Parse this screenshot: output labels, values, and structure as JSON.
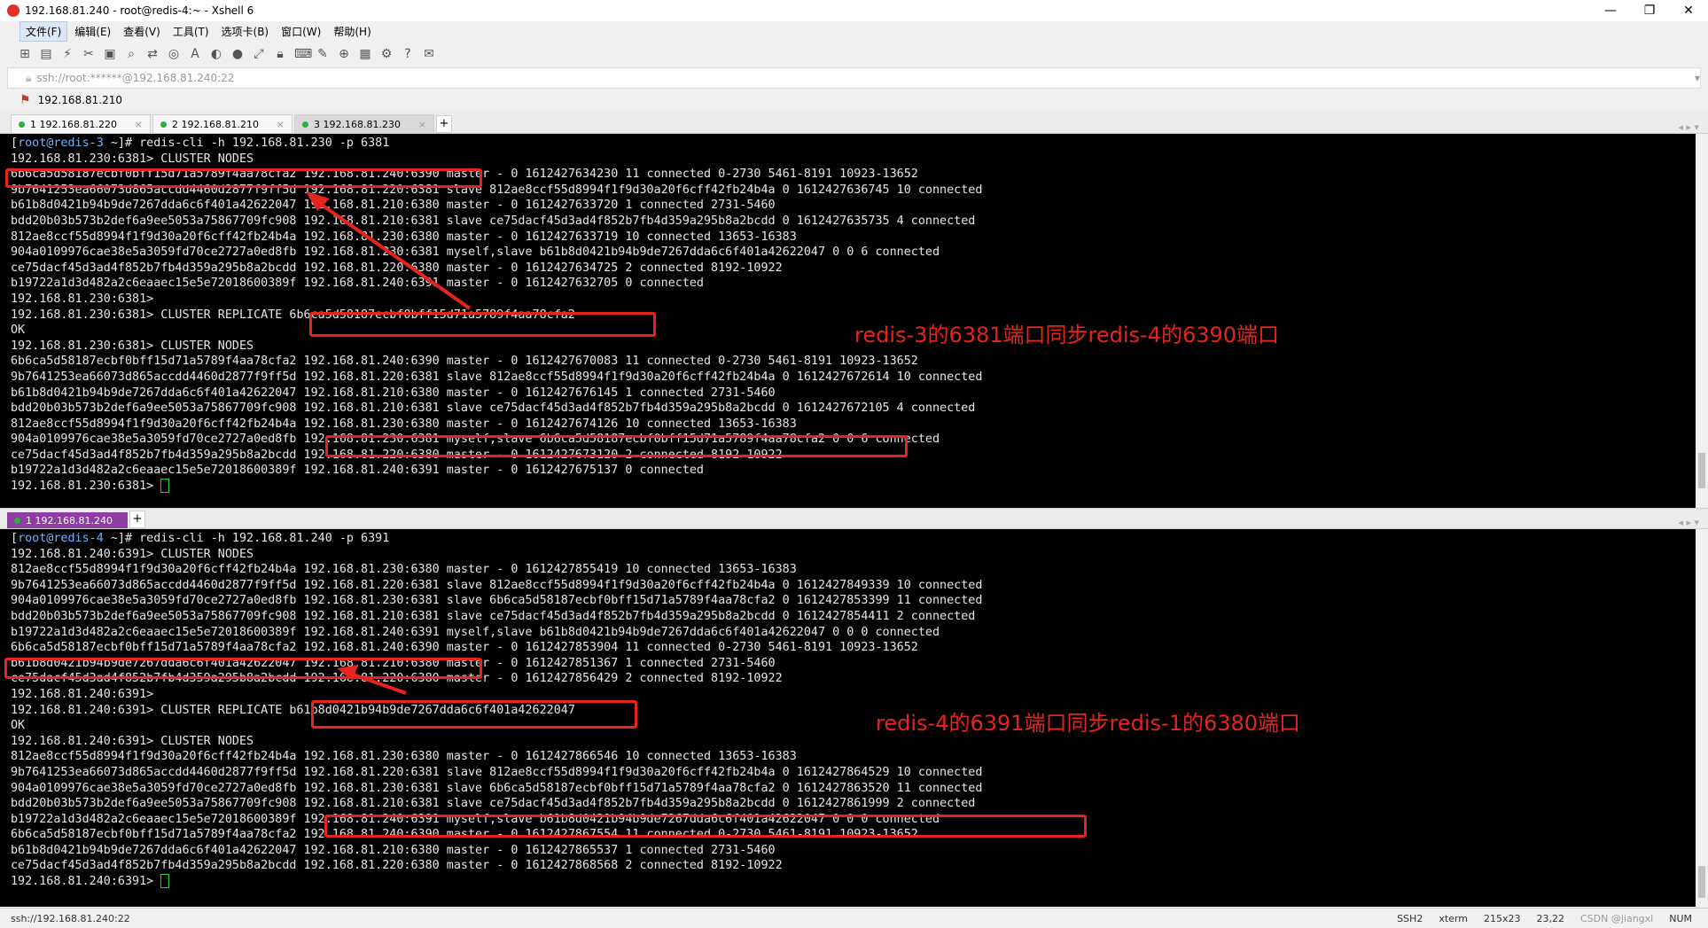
{
  "window": {
    "title": "192.168.81.240 - root@redis-4:~ - Xshell 6",
    "controls": [
      "—",
      "❐",
      "✕"
    ]
  },
  "menu": [
    "文件(F)",
    "编辑(E)",
    "查看(V)",
    "工具(T)",
    "选项卡(B)",
    "窗口(W)",
    "帮助(H)"
  ],
  "address": "ssh://root:******@192.168.81.240:22",
  "session_bar_label": "192.168.81.210",
  "tabs": [
    {
      "label": "1 192.168.81.220"
    },
    {
      "label": "2 192.168.81.210"
    },
    {
      "label": "3 192.168.81.230"
    }
  ],
  "pane2_tab": "1 192.168.81.240",
  "terminal1": {
    "prompt_user": "root@redis-3",
    "prompt_path": " ~]# redis-cli -h 192.168.81.230 -p 6381",
    "lines": [
      "192.168.81.230:6381> CLUSTER NODES",
      "6b6ca5d58187ecbf0bff15d71a5789f4aa78cfa2 192.168.81.240:6390 master - 0 1612427634230 11 connected 0-2730 5461-8191 10923-13652",
      "9b7641253ea66073d865accdd4460d2877f9ff5d 192.168.81.220:6381 slave 812ae8ccf55d8994f1f9d30a20f6cff42fb24b4a 0 1612427636745 10 connected",
      "b61b8d0421b94b9de7267dda6c6f401a42622047 192.168.81.210:6380 master - 0 1612427633720 1 connected 2731-5460",
      "bdd20b03b573b2def6a9ee5053a75867709fc908 192.168.81.210:6381 slave ce75dacf45d3ad4f852b7fb4d359a295b8a2bcdd 0 1612427635735 4 connected",
      "812ae8ccf55d8994f1f9d30a20f6cff42fb24b4a 192.168.81.230:6380 master - 0 1612427633719 10 connected 13653-16383",
      "904a0109976cae38e5a3059fd70ce2727a0ed8fb 192.168.81.230:6381 myself,slave b61b8d0421b94b9de7267dda6c6f401a42622047 0 0 6 connected",
      "ce75dacf45d3ad4f852b7fb4d359a295b8a2bcdd 192.168.81.220:6380 master - 0 1612427634725 2 connected 8192-10922",
      "b19722a1d3d482a2c6eaaec15e5e72018600389f 192.168.81.240:6391 master - 0 1612427632705 0 connected",
      "192.168.81.230:6381>",
      "192.168.81.230:6381> CLUSTER REPLICATE 6b6ca5d58187ecbf0bff15d71a5789f4aa78cfa2",
      "OK",
      "192.168.81.230:6381> CLUSTER NODES",
      "6b6ca5d58187ecbf0bff15d71a5789f4aa78cfa2 192.168.81.240:6390 master - 0 1612427670083 11 connected 0-2730 5461-8191 10923-13652",
      "9b7641253ea66073d865accdd4460d2877f9ff5d 192.168.81.220:6381 slave 812ae8ccf55d8994f1f9d30a20f6cff42fb24b4a 0 1612427672614 10 connected",
      "b61b8d0421b94b9de7267dda6c6f401a42622047 192.168.81.210:6380 master - 0 1612427676145 1 connected 2731-5460",
      "bdd20b03b573b2def6a9ee5053a75867709fc908 192.168.81.210:6381 slave ce75dacf45d3ad4f852b7fb4d359a295b8a2bcdd 0 1612427672105 4 connected",
      "812ae8ccf55d8994f1f9d30a20f6cff42fb24b4a 192.168.81.230:6380 master - 0 1612427674126 10 connected 13653-16383",
      "904a0109976cae38e5a3059fd70ce2727a0ed8fb 192.168.81.230:6381 myself,slave 6b6ca5d58187ecbf0bff15d71a5789f4aa78cfa2 0 0 6 connected",
      "ce75dacf45d3ad4f852b7fb4d359a295b8a2bcdd 192.168.81.220:6380 master - 0 1612427673120 2 connected 8192-10922",
      "b19722a1d3d482a2c6eaaec15e5e72018600389f 192.168.81.240:6391 master - 0 1612427675137 0 connected"
    ],
    "final_prompt": "192.168.81.230:6381> ",
    "annotation": "redis-3的6381端口同步redis-4的6390端口"
  },
  "terminal2": {
    "prompt_user": "root@redis-4",
    "prompt_path": " ~]# redis-cli -h 192.168.81.240 -p 6391",
    "lines": [
      "192.168.81.240:6391> CLUSTER NODES",
      "812ae8ccf55d8994f1f9d30a20f6cff42fb24b4a 192.168.81.230:6380 master - 0 1612427855419 10 connected 13653-16383",
      "9b7641253ea66073d865accdd4460d2877f9ff5d 192.168.81.220:6381 slave 812ae8ccf55d8994f1f9d30a20f6cff42fb24b4a 0 1612427849339 10 connected",
      "904a0109976cae38e5a3059fd70ce2727a0ed8fb 192.168.81.230:6381 slave 6b6ca5d58187ecbf0bff15d71a5789f4aa78cfa2 0 1612427853399 11 connected",
      "bdd20b03b573b2def6a9ee5053a75867709fc908 192.168.81.210:6381 slave ce75dacf45d3ad4f852b7fb4d359a295b8a2bcdd 0 1612427854411 2 connected",
      "b19722a1d3d482a2c6eaaec15e5e72018600389f 192.168.81.240:6391 myself,slave b61b8d0421b94b9de7267dda6c6f401a42622047 0 0 0 connected",
      "6b6ca5d58187ecbf0bff15d71a5789f4aa78cfa2 192.168.81.240:6390 master - 0 1612427853904 11 connected 0-2730 5461-8191 10923-13652",
      "b61b8d0421b94b9de7267dda6c6f401a42622047 192.168.81.210:6380 master - 0 1612427851367 1 connected 2731-5460",
      "ce75dacf45d3ad4f852b7fb4d359a295b8a2bcdd 192.168.81.220:6380 master - 0 1612427856429 2 connected 8192-10922",
      "192.168.81.240:6391>",
      "192.168.81.240:6391> CLUSTER REPLICATE b61b8d0421b94b9de7267dda6c6f401a42622047",
      "OK",
      "192.168.81.240:6391> CLUSTER NODES",
      "812ae8ccf55d8994f1f9d30a20f6cff42fb24b4a 192.168.81.230:6380 master - 0 1612427866546 10 connected 13653-16383",
      "9b7641253ea66073d865accdd4460d2877f9ff5d 192.168.81.220:6381 slave 812ae8ccf55d8994f1f9d30a20f6cff42fb24b4a 0 1612427864529 10 connected",
      "904a0109976cae38e5a3059fd70ce2727a0ed8fb 192.168.81.230:6381 slave 6b6ca5d58187ecbf0bff15d71a5789f4aa78cfa2 0 1612427863520 11 connected",
      "bdd20b03b573b2def6a9ee5053a75867709fc908 192.168.81.210:6381 slave ce75dacf45d3ad4f852b7fb4d359a295b8a2bcdd 0 1612427861999 2 connected",
      "b19722a1d3d482a2c6eaaec15e5e72018600389f 192.168.81.240:6391 myself,slave b61b8d0421b94b9de7267dda6c6f401a42622047 0 0 0 connected",
      "6b6ca5d58187ecbf0bff15d71a5789f4aa78cfa2 192.168.81.240:6390 master - 0 1612427867554 11 connected 0-2730 5461-8191 10923-13652",
      "b61b8d0421b94b9de7267dda6c6f401a42622047 192.168.81.210:6380 master - 0 1612427865537 1 connected 2731-5460",
      "ce75dacf45d3ad4f852b7fb4d359a295b8a2bcdd 192.168.81.220:6380 master - 0 1612427868568 2 connected 8192-10922"
    ],
    "final_prompt": "192.168.81.240:6391> ",
    "annotation": "redis-4的6391端口同步redis-1的6380端口"
  },
  "status": {
    "address": "ssh://192.168.81.240:22",
    "protocol": "SSH2",
    "term": "xterm",
    "size": "215x23",
    "pos": "23,22",
    "watermark": "CSDN @jiangxl",
    "num": "NUM"
  },
  "colors": {
    "annotation": "#e8231c",
    "active_tab2": "#8e3ea2",
    "prompt_user": "#6db3ff",
    "cursor": "#1ecf3b"
  }
}
